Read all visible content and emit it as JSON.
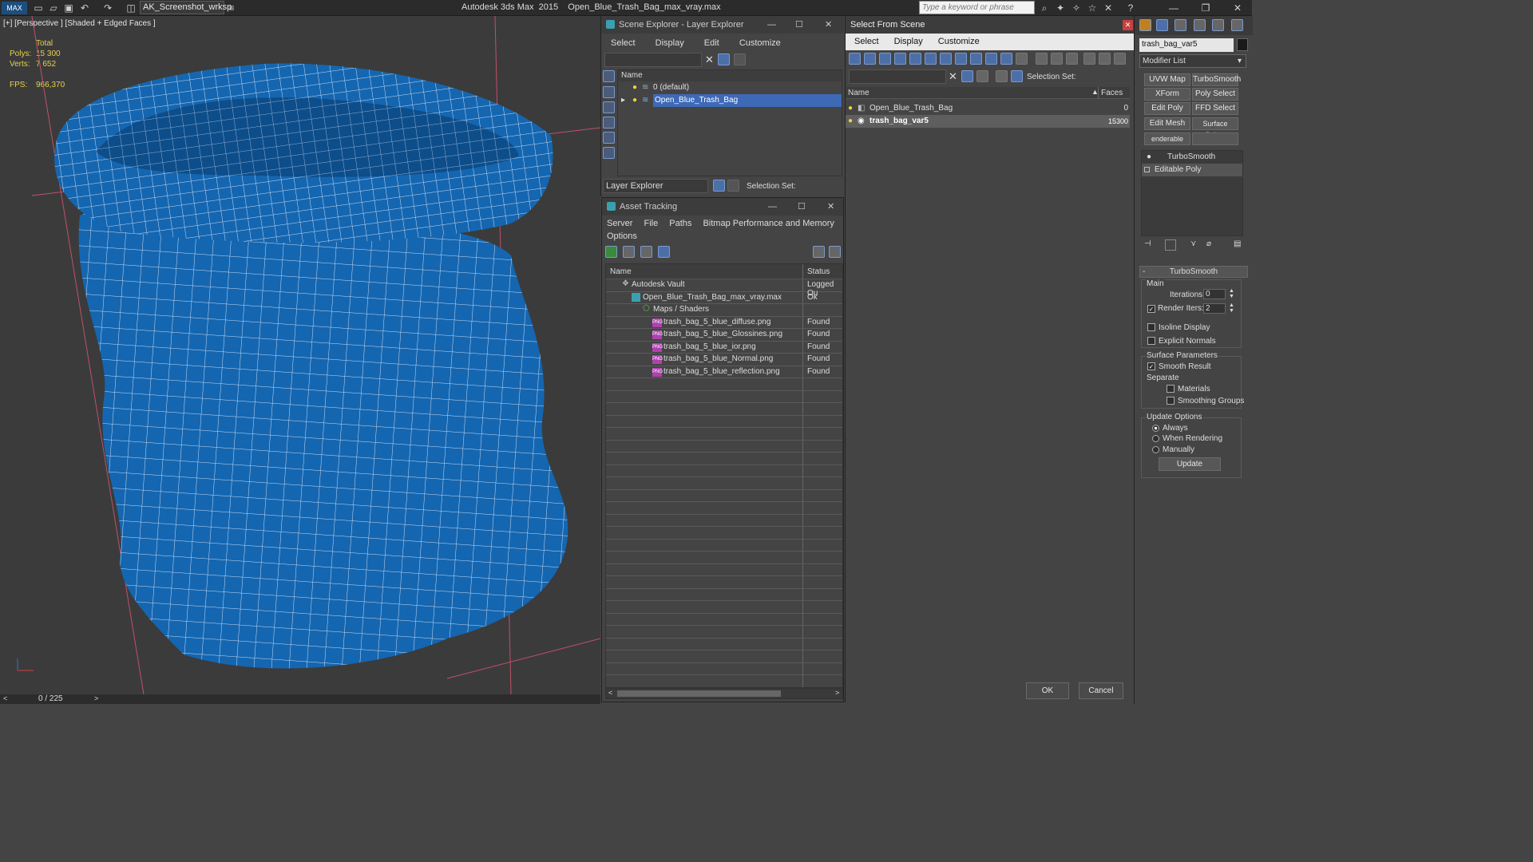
{
  "titlebar": {
    "workspace": "AK_Screenshot_wrksp",
    "app_title": "Autodesk 3ds Max  2015    Open_Blue_Trash_Bag_max_vray.max",
    "search_placeholder": "Type a keyword or phrase"
  },
  "viewport": {
    "label": "[+] [Perspective ] [Shaded + Edged Faces ]",
    "stats_header": "Total",
    "polys_label": "Polys:",
    "polys_value": "15 300",
    "verts_label": "Verts:",
    "verts_value": "7 652",
    "fps_label": "FPS:",
    "fps_value": "966,370",
    "timeline": "0 / 225",
    "mesh_color": "#1566b0"
  },
  "scene_explorer": {
    "title": "Scene Explorer - Layer Explorer",
    "menu": [
      "Select",
      "Display",
      "Edit",
      "Customize"
    ],
    "col_name": "Name",
    "layers": [
      "0 (default)",
      "Open_Blue_Trash_Bag"
    ],
    "footer_dropdown": "Layer Explorer",
    "selection_set": "Selection Set:"
  },
  "asset_tracking": {
    "title": "Asset Tracking",
    "menu": [
      "Server",
      "File",
      "Paths",
      "Bitmap Performance and Memory"
    ],
    "menu2": "Options",
    "col_name": "Name",
    "col_status": "Status",
    "rows": [
      {
        "name": "Autodesk Vault",
        "status": "Logged Ou"
      },
      {
        "name": "Open_Blue_Trash_Bag_max_vray.max",
        "status": "Ok"
      },
      {
        "name": "Maps / Shaders",
        "status": ""
      },
      {
        "name": "trash_bag_5_blue_diffuse.png",
        "status": "Found"
      },
      {
        "name": "trash_bag_5_blue_Glossines.png",
        "status": "Found"
      },
      {
        "name": "trash_bag_5_blue_ior.png",
        "status": "Found"
      },
      {
        "name": "trash_bag_5_blue_Normal.png",
        "status": "Found"
      },
      {
        "name": "trash_bag_5_blue_reflection.png",
        "status": "Found"
      }
    ]
  },
  "select_from_scene": {
    "title": "Select From Scene",
    "menu": [
      "Select",
      "Display",
      "Customize"
    ],
    "selection_set": "Selection Set:",
    "col_name": "Name",
    "col_faces": "Faces",
    "rows": [
      {
        "name": "Open_Blue_Trash_Bag",
        "faces": "0"
      },
      {
        "name": "trash_bag_var5",
        "faces": "15300"
      }
    ],
    "ok": "OK",
    "cancel": "Cancel"
  },
  "command_panel": {
    "object_name": "trash_bag_var5",
    "modifier_list": "Modifier List",
    "buttons": [
      "UVW Map",
      "TurboSmooth",
      "XForm",
      "Poly Select",
      "Edit Poly",
      "FFD Select",
      "Edit Mesh",
      "Surface Select",
      "enderable Splir"
    ],
    "stack": [
      "TurboSmooth",
      "Editable Poly"
    ],
    "rollout_title": "TurboSmooth",
    "main": "Main",
    "iterations_label": "Iterations:",
    "iterations_value": "0",
    "render_iters_label": "Render Iters:",
    "render_iters_value": "2",
    "isoline": "Isoline Display",
    "explicit_normals": "Explicit Normals",
    "surface_params": "Surface Parameters",
    "smooth_result": "Smooth Result",
    "separate": "Separate",
    "materials": "Materials",
    "smoothing_groups": "Smoothing Groups",
    "update_options": "Update Options",
    "always": "Always",
    "when_rendering": "When Rendering",
    "manually": "Manually",
    "update_btn": "Update"
  }
}
